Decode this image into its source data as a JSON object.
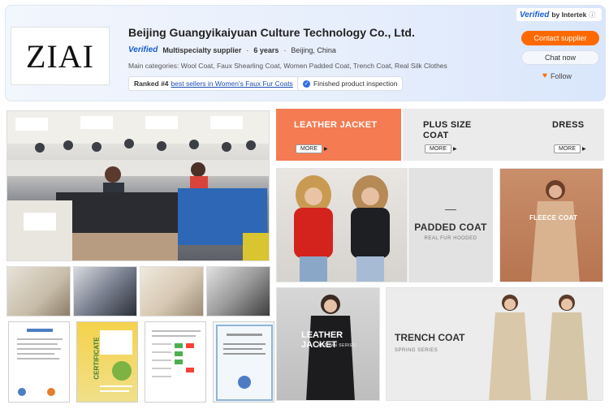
{
  "header": {
    "logo_text": "ZIAI",
    "company_name": "Beijing Guangyikaiyuan Culture Technology Co., Ltd.",
    "verified_label": "Verified",
    "supplier_type": "Multispecialty supplier",
    "years": "6 years",
    "location": "Beijing, China",
    "main_categories": "Main categories: Wool Coat, Faux Shearling Coat, Women Padded Coat, Trench Coat, Real Silk Clothes",
    "ranked_prefix": "Ranked #4",
    "ranked_link": "best sellers in Women's Faux Fur Coats",
    "inspection": "Finished product inspection",
    "intertek_verified": "Verified",
    "intertek_by": "by Intertek",
    "contact_button": "Contact supplier",
    "chat_button": "Chat now",
    "follow_button": "Follow"
  },
  "categories": [
    {
      "label": "LEATHER JACKET",
      "more": "MORE"
    },
    {
      "label": "PLUS SIZE COAT",
      "more": "MORE"
    },
    {
      "label": "DRESS",
      "more": "MORE"
    }
  ],
  "panels": {
    "padded_title": "PADDED COAT",
    "padded_sub": "REAL FUR HOODED",
    "fleece_title": "FLEECE COAT",
    "leather_title": "LEATHER JACKET",
    "leather_sub": "AUTUMN SERIES",
    "trench_title": "TRENCH COAT",
    "trench_sub": "SPRING SERIES"
  },
  "certificate_label": "CERTIFICATE",
  "colors": {
    "accent_orange": "#ff6a00",
    "leather_banner": "#f47b52",
    "verified_blue": "#1a5fd1"
  }
}
